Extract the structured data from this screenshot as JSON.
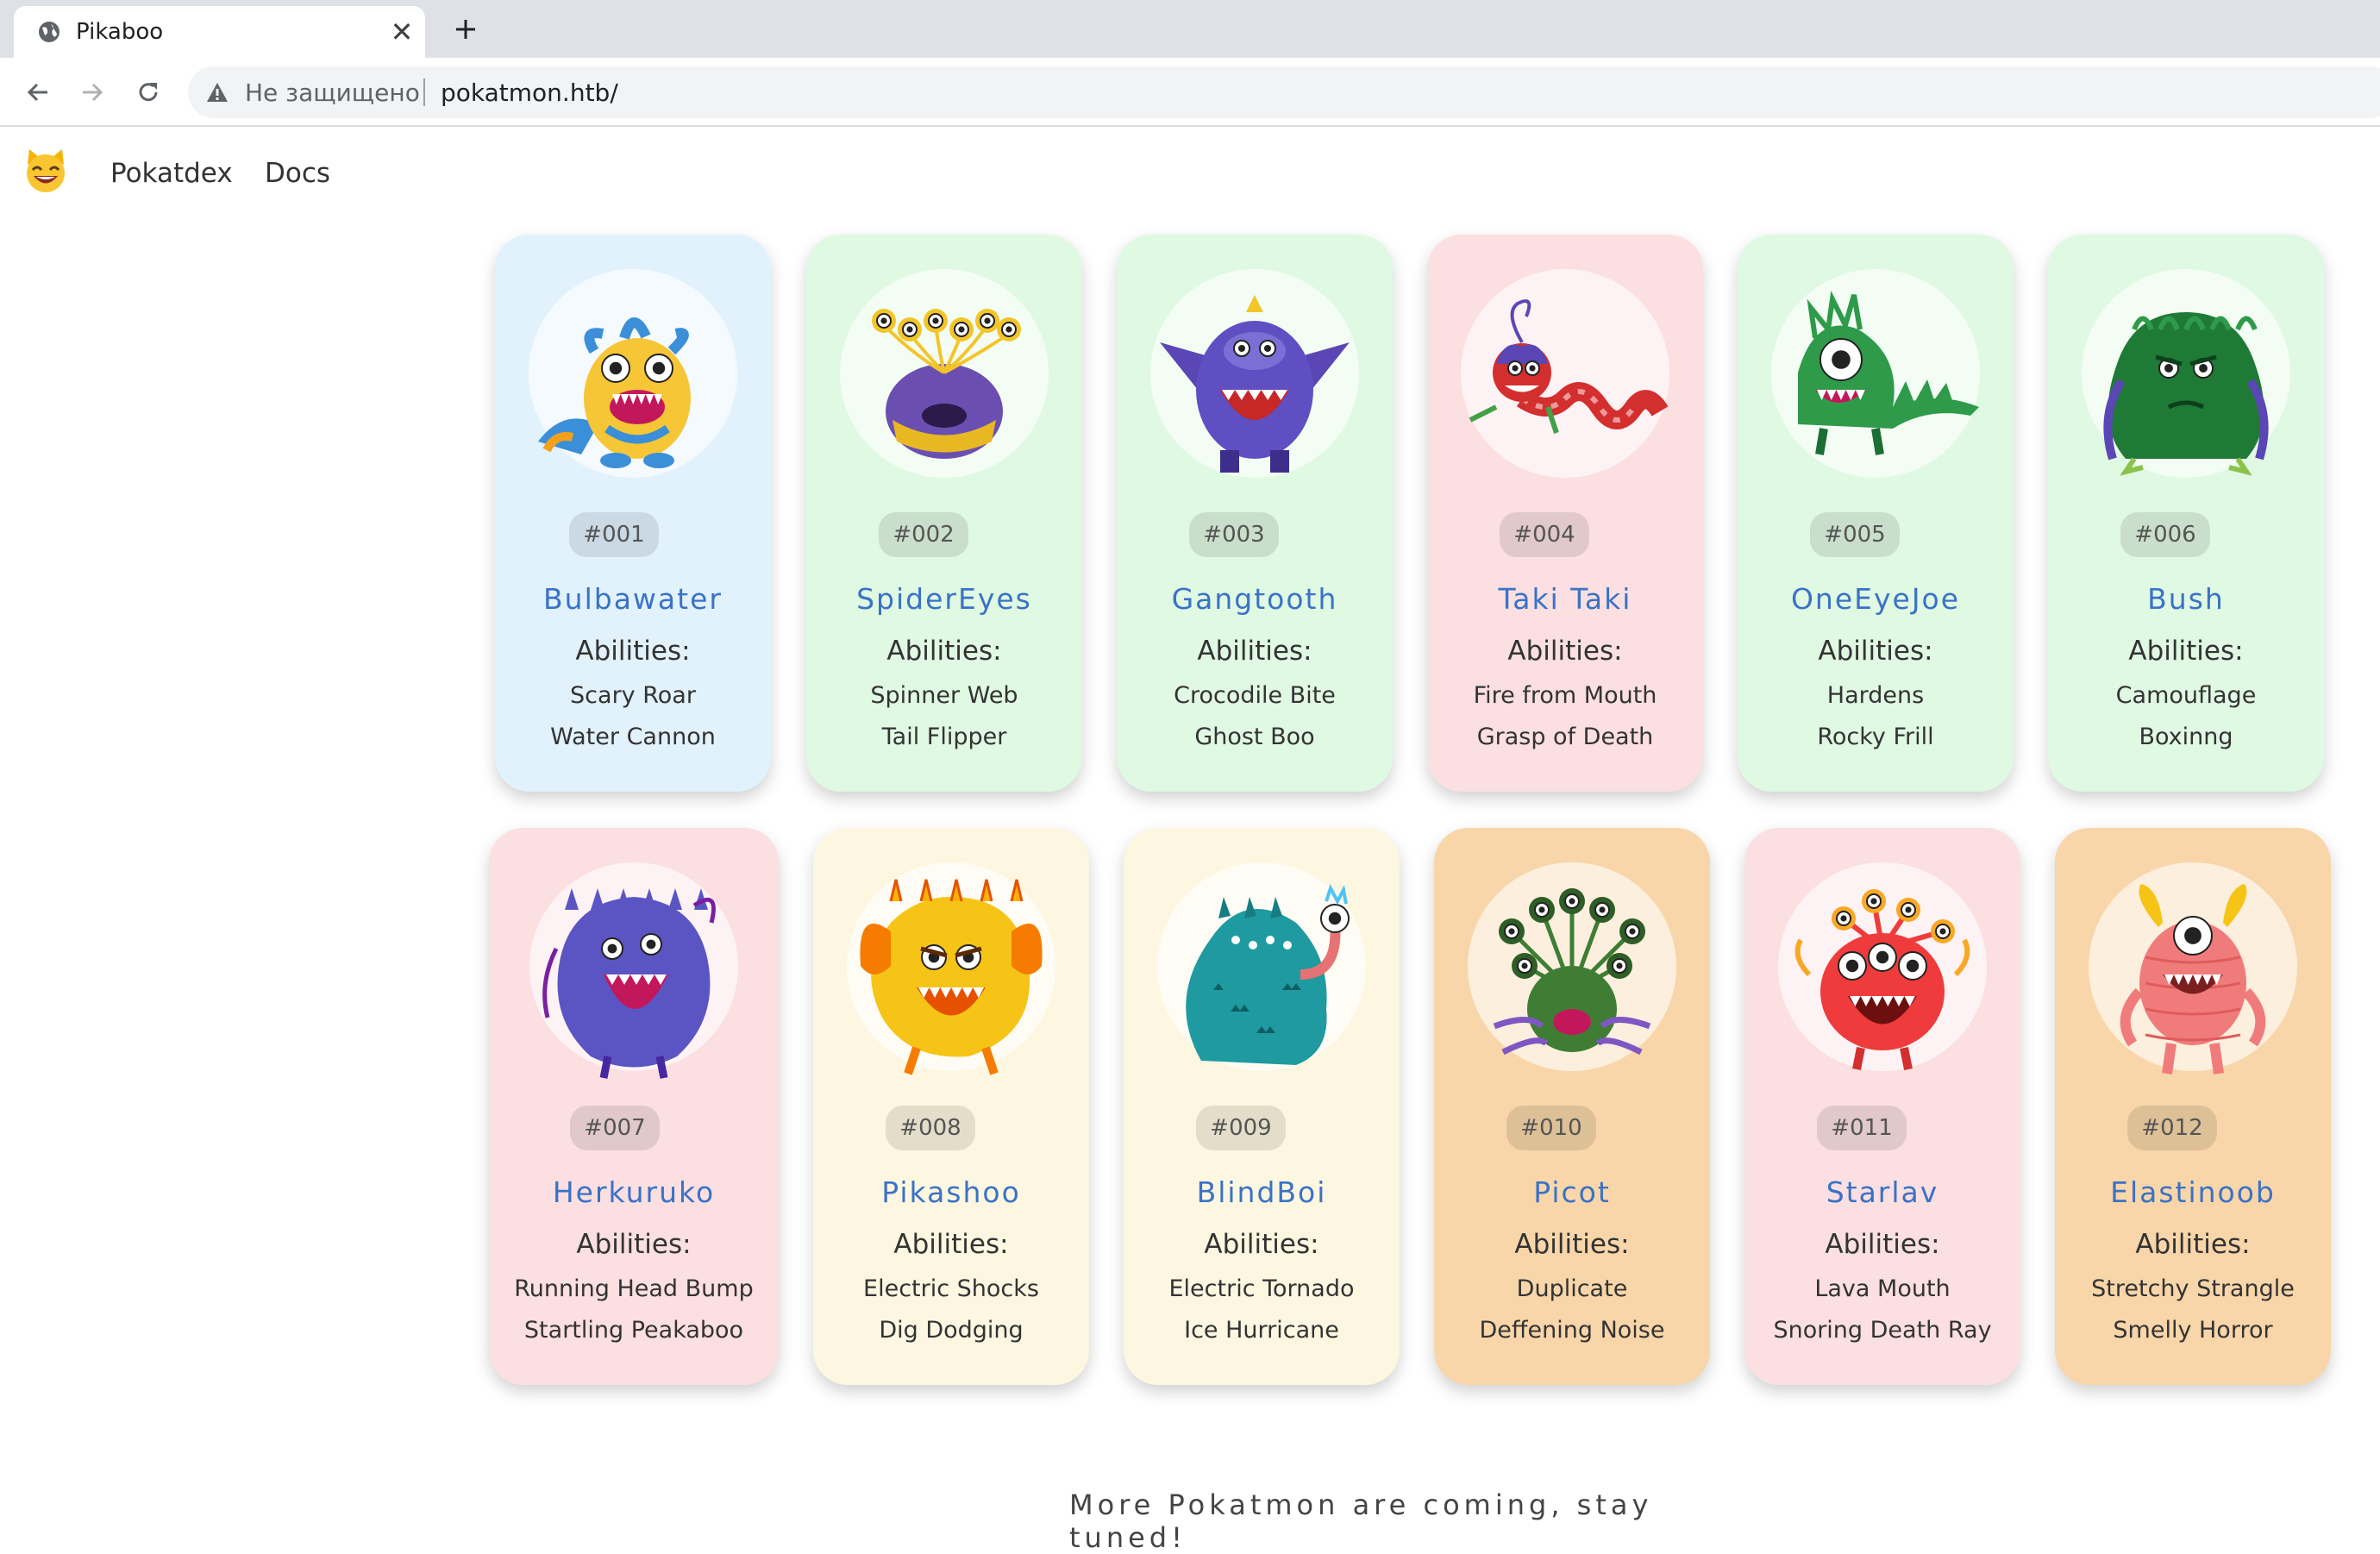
{
  "browser": {
    "tab_title": "Pikaboo",
    "close_glyph": "✕",
    "insecure_label": "Не защищено",
    "url": "pokatmon.htb/"
  },
  "site": {
    "logo_icon": "cat-face-icon",
    "nav": [
      {
        "label": "Pokatdex"
      },
      {
        "label": "Docs"
      }
    ]
  },
  "monsters": [
    {
      "number": "#001",
      "name": "Bulbawater",
      "abilities_title": "Abilities:",
      "abilities": [
        "Scary Roar",
        "Water Cannon"
      ],
      "bg": "#e1f2fd"
    },
    {
      "number": "#002",
      "name": "SpiderEyes",
      "abilities_title": "Abilities:",
      "abilities": [
        "Spinner Web",
        "Tail Flipper"
      ],
      "bg": "#e0f9e3"
    },
    {
      "number": "#003",
      "name": "Gangtooth",
      "abilities_title": "Abilities:",
      "abilities": [
        "Crocodile Bite",
        "Ghost Boo"
      ],
      "bg": "#e0f9e3"
    },
    {
      "number": "#004",
      "name": "Taki Taki",
      "abilities_title": "Abilities:",
      "abilities": [
        "Fire from Mouth",
        "Grasp of Death"
      ],
      "bg": "#fbdfe1"
    },
    {
      "number": "#005",
      "name": "OneEyeJoe",
      "abilities_title": "Abilities:",
      "abilities": [
        "Hardens",
        "Rocky Frill"
      ],
      "bg": "#e0f9e3"
    },
    {
      "number": "#006",
      "name": "Bush",
      "abilities_title": "Abilities:",
      "abilities": [
        "Camouflage",
        "Boxinng"
      ],
      "bg": "#e0f9e3"
    },
    {
      "number": "#007",
      "name": "Herkuruko",
      "abilities_title": "Abilities:",
      "abilities": [
        "Running Head Bump",
        "Startling Peakaboo"
      ],
      "bg": "#fbdfe1"
    },
    {
      "number": "#008",
      "name": "Pikashoo",
      "abilities_title": "Abilities:",
      "abilities": [
        "Electric Shocks",
        "Dig Dodging"
      ],
      "bg": "#fdf7e1"
    },
    {
      "number": "#009",
      "name": "BlindBoi",
      "abilities_title": "Abilities:",
      "abilities": [
        "Electric Tornado",
        "Ice Hurricane"
      ],
      "bg": "#fdf7e1"
    },
    {
      "number": "#010",
      "name": "Picot",
      "abilities_title": "Abilities:",
      "abilities": [
        "Duplicate",
        "Deffening Noise"
      ],
      "bg": "#f8d6a9"
    },
    {
      "number": "#011",
      "name": "Starlav",
      "abilities_title": "Abilities:",
      "abilities": [
        "Lava Mouth",
        "Snoring Death Ray"
      ],
      "bg": "#fbdfe1"
    },
    {
      "number": "#012",
      "name": "Elastinoob",
      "abilities_title": "Abilities:",
      "abilities": [
        "Stretchy Strangle",
        "Smelly Horror"
      ],
      "bg": "#f8d6a9"
    }
  ],
  "footer": {
    "message": "More Pokatmon are coming, stay tuned!"
  },
  "colors": {
    "name_link": "#3a72c6",
    "text": "#333333"
  }
}
